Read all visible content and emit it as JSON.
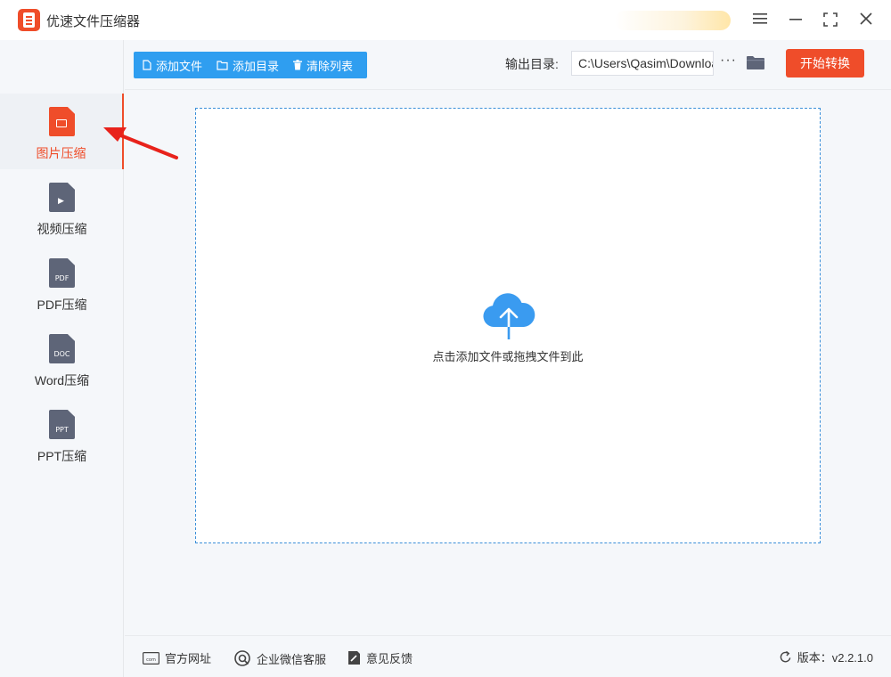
{
  "app": {
    "title": "优速文件压缩器"
  },
  "sidebar": {
    "items": [
      {
        "label": "图片压缩",
        "icon": "image-file-icon",
        "tag": "",
        "active": true
      },
      {
        "label": "视频压缩",
        "icon": "video-file-icon",
        "tag": ""
      },
      {
        "label": "PDF压缩",
        "icon": "pdf-file-icon",
        "tag": "PDF"
      },
      {
        "label": "Word压缩",
        "icon": "word-file-icon",
        "tag": "DOC"
      },
      {
        "label": "PPT压缩",
        "icon": "ppt-file-icon",
        "tag": "PPT"
      }
    ]
  },
  "toolbar": {
    "add_file": "添加文件",
    "add_folder": "添加目录",
    "clear_list": "清除列表",
    "output_label": "输出目录:",
    "output_path": "C:\\Users\\Qasim\\Downloads",
    "more": "···",
    "start": "开始转换"
  },
  "dropzone": {
    "hint": "点击添加文件或拖拽文件到此"
  },
  "footer": {
    "website": "官方网址",
    "wechat": "企业微信客服",
    "feedback": "意见反馈",
    "version": "版本：v2.2.1.0"
  },
  "colors": {
    "accent": "#ef4d2a",
    "primary": "#2f9ef0",
    "cloud": "#3a9bf0"
  }
}
